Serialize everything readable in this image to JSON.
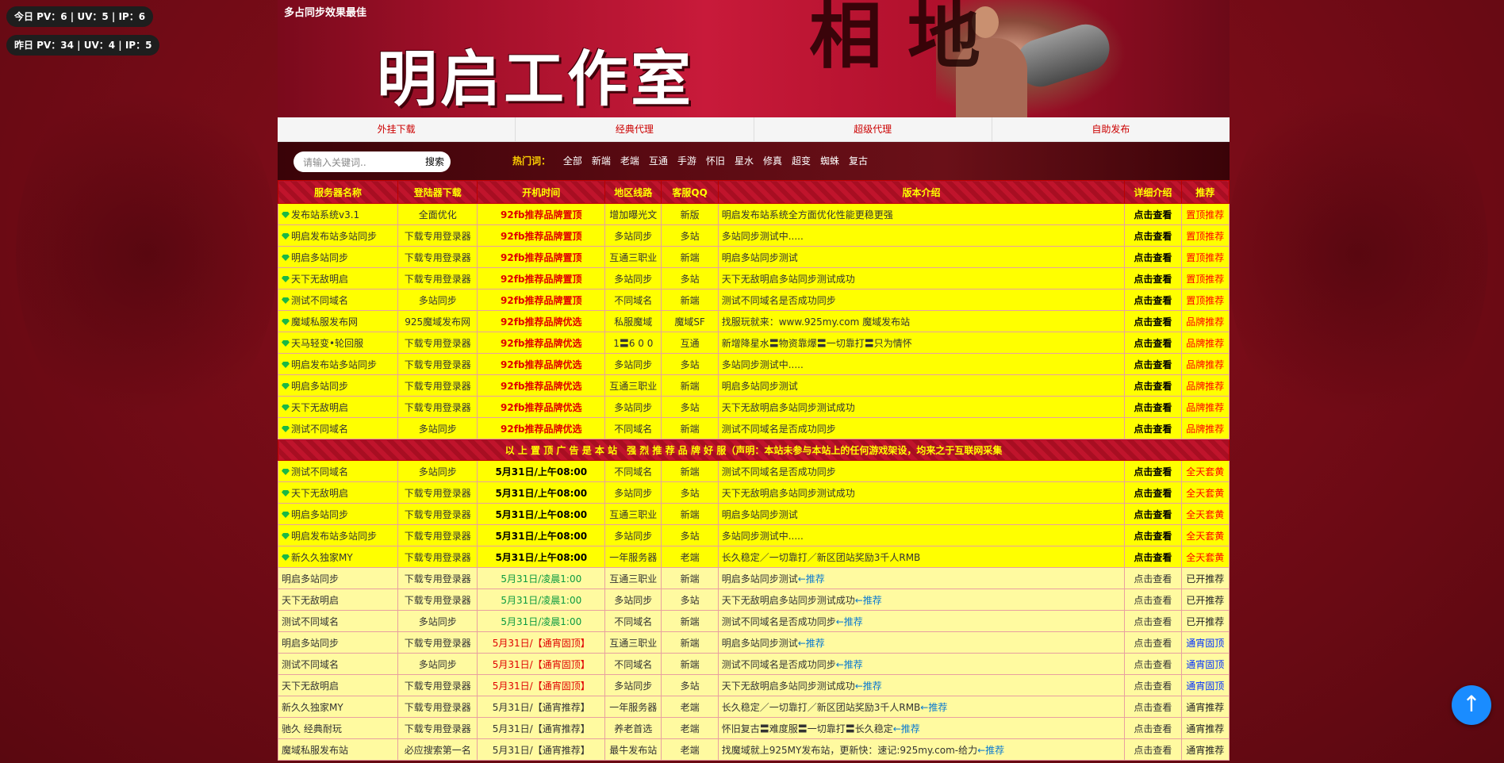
{
  "stats": {
    "today": "今日 PV：6 | UV：5 | IP：6",
    "yesterday": "昨日 PV：34 | UV：4 | IP：5"
  },
  "banner": {
    "tagline": "多占同步效果最佳",
    "studio": "明启工作室",
    "calligraphy": "相 地"
  },
  "nav": [
    "外挂下载",
    "经典代理",
    "超级代理",
    "自助发布"
  ],
  "search": {
    "placeholder": "请输入关键词..",
    "button": "搜索"
  },
  "hot": {
    "label": "热门词：",
    "tags": [
      "全部",
      "新端",
      "老端",
      "互通",
      "手游",
      "怀旧",
      "星水",
      "修真",
      "超变",
      "蜘蛛",
      "复古"
    ]
  },
  "table": {
    "headers": [
      "服务器名称",
      "登陆器下载",
      "开机时间",
      "地区线路",
      "客服QQ",
      "版本介绍",
      "详细介绍",
      "推荐"
    ],
    "top_rows": [
      {
        "name": "发布站系统v3.1",
        "download": "全面优化",
        "time": "92fb推荐品牌置顶",
        "line": "增加曝光文",
        "qq": "新版",
        "desc": "明启发布站系统全方面优化性能更稳更强",
        "detail": "点击查看",
        "badge": "置顶推荐"
      },
      {
        "name": "明启发布站多站同步",
        "download": "下载专用登录器",
        "time": "92fb推荐品牌置顶",
        "line": "多站同步",
        "qq": "多站",
        "desc": "多站同步测试中.....",
        "detail": "点击查看",
        "badge": "置顶推荐"
      },
      {
        "name": "明启多站同步",
        "download": "下载专用登录器",
        "time": "92fb推荐品牌置顶",
        "line": "互通三职业",
        "qq": "新端",
        "desc": "明启多站同步测试",
        "detail": "点击查看",
        "badge": "置顶推荐"
      },
      {
        "name": "天下无敌明启",
        "download": "下载专用登录器",
        "time": "92fb推荐品牌置顶",
        "line": "多站同步",
        "qq": "多站",
        "desc": "天下无敌明启多站同步测试成功",
        "detail": "点击查看",
        "badge": "置顶推荐"
      },
      {
        "name": "测试不同域名",
        "download": "多站同步",
        "time": "92fb推荐品牌置顶",
        "line": "不同域名",
        "qq": "新端",
        "desc": "测试不同域名是否成功同步",
        "detail": "点击查看",
        "badge": "置顶推荐"
      },
      {
        "name": "魔域私服发布网",
        "download": "925魔域发布网",
        "time": "92fb推荐品牌优选",
        "line": "私服魔域",
        "qq": "魔域SF",
        "desc": "找服玩就来：www.925my.com 魔域发布站",
        "detail": "点击查看",
        "badge": "品牌推荐"
      },
      {
        "name": "天马轻变•轮回服",
        "download": "下载专用登录器",
        "time": "92fb推荐品牌优选",
        "line": "1〓6 0 0",
        "qq": "互通",
        "desc": "新增降星水〓物资靠爆〓一切靠打〓只为情怀",
        "detail": "点击查看",
        "badge": "品牌推荐"
      },
      {
        "name": "明启发布站多站同步",
        "download": "下载专用登录器",
        "time": "92fb推荐品牌优选",
        "line": "多站同步",
        "qq": "多站",
        "desc": "多站同步测试中.....",
        "detail": "点击查看",
        "badge": "品牌推荐"
      },
      {
        "name": "明启多站同步",
        "download": "下载专用登录器",
        "time": "92fb推荐品牌优选",
        "line": "互通三职业",
        "qq": "新端",
        "desc": "明启多站同步测试",
        "detail": "点击查看",
        "badge": "品牌推荐"
      },
      {
        "name": "天下无敌明启",
        "download": "下载专用登录器",
        "time": "92fb推荐品牌优选",
        "line": "多站同步",
        "qq": "多站",
        "desc": "天下无敌明启多站同步测试成功",
        "detail": "点击查看",
        "badge": "品牌推荐"
      },
      {
        "name": "测试不同域名",
        "download": "多站同步",
        "time": "92fb推荐品牌优选",
        "line": "不同域名",
        "qq": "新端",
        "desc": "测试不同域名是否成功同步",
        "detail": "点击查看",
        "badge": "品牌推荐"
      }
    ],
    "notice": "以 上 置 顶 广 告 是 本 站　强 烈 推 荐 品 牌 好 服（声明：本站未参与本站上的任何游戏架设，均来之于互联网采集",
    "day_rows": [
      {
        "name": "测试不同域名",
        "download": "多站同步",
        "time": "5月31日/上午08:00",
        "line": "不同域名",
        "qq": "新端",
        "desc": "测试不同域名是否成功同步",
        "detail": "点击查看",
        "badge": "全天套黄"
      },
      {
        "name": "天下无敌明启",
        "download": "下载专用登录器",
        "time": "5月31日/上午08:00",
        "line": "多站同步",
        "qq": "多站",
        "desc": "天下无敌明启多站同步测试成功",
        "detail": "点击查看",
        "badge": "全天套黄"
      },
      {
        "name": "明启多站同步",
        "download": "下载专用登录器",
        "time": "5月31日/上午08:00",
        "line": "互通三职业",
        "qq": "新端",
        "desc": "明启多站同步测试",
        "detail": "点击查看",
        "badge": "全天套黄"
      },
      {
        "name": "明启发布站多站同步",
        "download": "下载专用登录器",
        "time": "5月31日/上午08:00",
        "line": "多站同步",
        "qq": "多站",
        "desc": "多站同步测试中.....",
        "detail": "点击查看",
        "badge": "全天套黄"
      },
      {
        "name": "新久久独家MY",
        "download": "下载专用登录器",
        "time": "5月31日/上午08:00",
        "line": "一年服务器",
        "qq": "老端",
        "desc": "长久稳定／一切靠打／新区团站奖励3千人RMB",
        "detail": "点击查看",
        "badge": "全天套黄"
      }
    ],
    "other_rows": [
      {
        "name": "明启多站同步",
        "download": "下载专用登录器",
        "time": "5月31日/凌晨1:00",
        "time_style": "green",
        "line": "互通三职业",
        "qq": "新端",
        "desc": "明启多站同步测试",
        "rec": "←推荐",
        "detail": "点击查看",
        "badge": "已开推荐",
        "badge_style": "dark"
      },
      {
        "name": "天下无敌明启",
        "download": "下载专用登录器",
        "time": "5月31日/凌晨1:00",
        "time_style": "green",
        "line": "多站同步",
        "qq": "多站",
        "desc": "天下无敌明启多站同步测试成功",
        "rec": "←推荐",
        "detail": "点击查看",
        "badge": "已开推荐",
        "badge_style": "dark"
      },
      {
        "name": "测试不同域名",
        "download": "多站同步",
        "time": "5月31日/凌晨1:00",
        "time_style": "green",
        "line": "不同域名",
        "qq": "新端",
        "desc": "测试不同域名是否成功同步",
        "rec": "←推荐",
        "detail": "点击查看",
        "badge": "已开推荐",
        "badge_style": "dark"
      },
      {
        "name": "明启多站同步",
        "download": "下载专用登录器",
        "time": "5月31日/【通宵固顶】",
        "time_style": "redsoft",
        "line": "互通三职业",
        "qq": "新端",
        "desc": "明启多站同步测试",
        "rec": "←推荐",
        "detail": "点击查看",
        "badge": "通宵固顶",
        "badge_style": "blue"
      },
      {
        "name": "测试不同域名",
        "download": "多站同步",
        "time": "5月31日/【通宵固顶】",
        "time_style": "redsoft",
        "line": "不同域名",
        "qq": "新端",
        "desc": "测试不同域名是否成功同步",
        "rec": "←推荐",
        "detail": "点击查看",
        "badge": "通宵固顶",
        "badge_style": "blue"
      },
      {
        "name": "天下无敌明启",
        "download": "下载专用登录器",
        "time": "5月31日/【通宵固顶】",
        "time_style": "redsoft",
        "line": "多站同步",
        "qq": "多站",
        "desc": "天下无敌明启多站同步测试成功",
        "rec": "←推荐",
        "detail": "点击查看",
        "badge": "通宵固顶",
        "badge_style": "blue"
      },
      {
        "name": "新久久独家MY",
        "download": "下载专用登录器",
        "time": "5月31日/【通宵推荐】",
        "time_style": "plain",
        "line": "一年服务器",
        "qq": "老端",
        "desc": "长久稳定／一切靠打／新区团站奖励3千人RMB",
        "rec": "←推荐",
        "detail": "点击查看",
        "badge": "通宵推荐",
        "badge_style": "dark"
      },
      {
        "name": "驰久 经典耐玩",
        "download": "下载专用登录器",
        "time": "5月31日/【通宵推荐】",
        "time_style": "plain",
        "line": "养老首选",
        "qq": "老端",
        "desc": "怀旧复古〓难度服〓一切靠打〓长久稳定",
        "rec": "←推荐",
        "detail": "点击查看",
        "badge": "通宵推荐",
        "badge_style": "dark"
      },
      {
        "name": "魔域私服发布站",
        "download": "必应搜索第一名",
        "time": "5月31日/【通宵推荐】",
        "time_style": "plain",
        "line": "最牛发布站",
        "qq": "老端",
        "desc": "找魔域就上925MY发布站，更新快：速记:925my.com-给力",
        "rec": "←推荐",
        "detail": "点击查看",
        "badge": "通宵推荐",
        "badge_style": "dark"
      }
    ]
  },
  "back_to_top": "↑",
  "colors": {
    "background": "#7a0c18",
    "row_highlight": "#ffff00",
    "row_normal": "#fffaa0",
    "header_text": "#ffff00",
    "accent_red": "#e00000",
    "link_blue": "#0030ff",
    "back_to_top": "#1a8cff"
  }
}
